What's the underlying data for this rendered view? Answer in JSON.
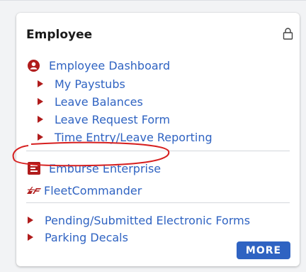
{
  "card": {
    "title": "Employee",
    "lock_icon": "lock-icon",
    "more_label": "MORE"
  },
  "primary_link": {
    "label": "Employee Dashboard",
    "icon": "user-circle-icon",
    "sub_items": [
      {
        "label": "My Paystubs"
      },
      {
        "label": "Leave Balances"
      },
      {
        "label": "Leave Request Form"
      },
      {
        "label": "Time Entry/Leave Reporting"
      }
    ]
  },
  "apps": [
    {
      "label": "Emburse Enterprise",
      "icon": "emburse-logo-icon"
    },
    {
      "label": "FleetCommander",
      "icon": "fleetcommander-logo-icon"
    }
  ],
  "bottom_links": [
    {
      "label": "Pending/Submitted Electronic Forms"
    },
    {
      "label": "Parking Decals"
    }
  ],
  "colors": {
    "link": "#2f63c2",
    "bullet": "#b01c1c",
    "button": "#2f63c2",
    "annotation": "#d61f1f"
  }
}
